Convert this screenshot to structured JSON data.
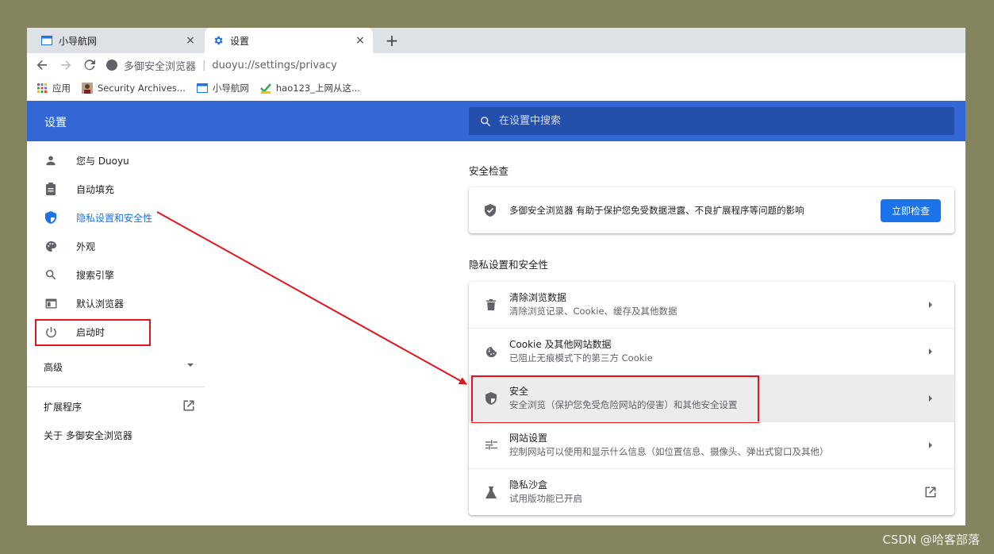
{
  "browser": {
    "tabs": [
      {
        "label": "小导航网",
        "close": "×"
      },
      {
        "label": "设置",
        "close": "×"
      }
    ],
    "new_tab": "+",
    "omnibox": {
      "site_name": "多御安全浏览器",
      "separator": "|",
      "url": "duoyu://settings/privacy"
    },
    "bookmarks": [
      {
        "label": "应用",
        "icon": "apps-grid-icon"
      },
      {
        "label": "Security Archives...",
        "icon": "avatar-icon"
      },
      {
        "label": "小导航网",
        "icon": "page-icon"
      },
      {
        "label": "hao123_上网从这...",
        "icon": "hao123-icon"
      }
    ]
  },
  "settings": {
    "title": "设置",
    "search_placeholder": "在设置中搜索",
    "sidebar": {
      "items": [
        {
          "label": "您与 Duoyu",
          "icon": "person-icon"
        },
        {
          "label": "自动填充",
          "icon": "clipboard-icon"
        },
        {
          "label": "隐私设置和安全性",
          "icon": "shield-icon"
        },
        {
          "label": "外观",
          "icon": "palette-icon"
        },
        {
          "label": "搜索引擎",
          "icon": "search-icon"
        },
        {
          "label": "默认浏览器",
          "icon": "browser-icon"
        },
        {
          "label": "启动时",
          "icon": "power-icon"
        }
      ],
      "advanced": "高级",
      "extensions": "扩展程序",
      "about": "关于 多御安全浏览器"
    },
    "safety_check": {
      "section_title": "安全检查",
      "text": "多御安全浏览器 有助于保护您免受数据泄露、不良扩展程序等问题的影响",
      "button": "立即检查"
    },
    "privacy": {
      "section_title": "隐私设置和安全性",
      "rows": [
        {
          "title": "清除浏览数据",
          "subtitle": "清除浏览记录、Cookie、缓存及其他数据",
          "icon": "trash-icon"
        },
        {
          "title": "Cookie 及其他网站数据",
          "subtitle": "已阻止无痕模式下的第三方 Cookie",
          "icon": "cookie-icon"
        },
        {
          "title": "安全",
          "subtitle": "安全浏览（保护您免受危险网站的侵害）和其他安全设置",
          "icon": "shield-icon"
        },
        {
          "title": "网站设置",
          "subtitle": "控制网站可以使用和显示什么信息（如位置信息、摄像头、弹出式窗口及其他）",
          "icon": "sliders-icon"
        },
        {
          "title": "隐私沙盒",
          "subtitle": "试用版功能已开启",
          "icon": "flask-icon"
        }
      ]
    }
  },
  "annotation_color": "#e3141b",
  "watermark": "CSDN @哈客部落"
}
